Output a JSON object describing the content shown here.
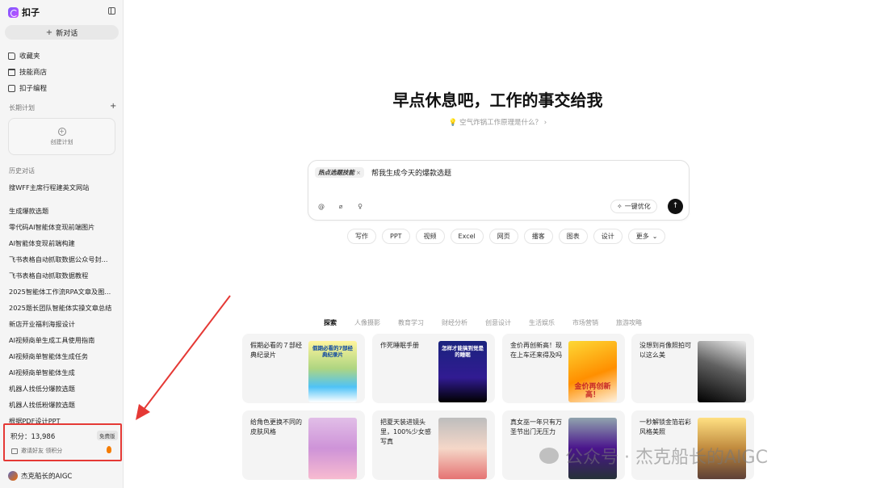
{
  "app": {
    "name": "扣子"
  },
  "sidebar": {
    "new_chat": "新对话",
    "nav": [
      {
        "label": "收藏夹",
        "icon": "folder-icon"
      },
      {
        "label": "技能商店",
        "icon": "store-icon"
      },
      {
        "label": "扣子编程",
        "icon": "code-icon"
      }
    ],
    "long_term_plan": {
      "title": "长期计划",
      "create": "创建计划"
    },
    "history_title": "历史对话",
    "history": [
      "搜WFF主席行程建英文网站",
      "生成爆款选题",
      "零代码AI智能体变现前端图片",
      "AI智能体变现前端构建",
      "飞书表格自动抓取数据公众号封...",
      "飞书表格自动抓取数据教程",
      "2025智能体工作流RPA文章及图...",
      "2025题长团队智能体实操文章总结",
      "新店开业福利海报设计",
      "AI视频商单生成工具使用指南",
      "AI视频商单智能体生成任务",
      "AI视频商单智能体生成",
      "机器人找低分爆款选题",
      "机器人找低粉爆款选题",
      "根据PDF设计PPT"
    ],
    "points": {
      "label": "积分：13,986",
      "badge": "免费版",
      "invite": "邀请好友 领积分"
    },
    "user": {
      "name": "杰克船长的AIGC"
    }
  },
  "main": {
    "title": "早点休息吧，工作的事交给我",
    "hint": "空气炸锅工作原理是什么？",
    "input": {
      "skill": "热点选题技能",
      "text": "帮我生成今天的爆款选题",
      "optimize": "一键优化"
    },
    "quick": [
      "写作",
      "PPT",
      "视频",
      "Excel",
      "网页",
      "播客",
      "图表",
      "设计",
      "更多"
    ],
    "categories": [
      "探索",
      "人像摄影",
      "教育学习",
      "财经分析",
      "创意设计",
      "生活娱乐",
      "市场营销",
      "旅游攻略"
    ],
    "cards": [
      {
        "text": "假期必看的７部经典纪录片",
        "img_caption": "假期必看的7部经典纪录片"
      },
      {
        "text": "作死睡眠手册",
        "img_caption": "怎样才能搞到觉是的睡眠"
      },
      {
        "text": "金价再创新高！现在上车还来得及吗",
        "img_caption": "金价再创新高！"
      },
      {
        "text": "没想到肖像照拍可以这么美",
        "img_caption": ""
      },
      {
        "text": "给角色更换不同的皮肤风格",
        "img_caption": ""
      },
      {
        "text": "把夏天装进镜头里，100%少女感写真",
        "img_caption": ""
      },
      {
        "text": "真女巫一年只有万圣节出门无压力",
        "img_caption": ""
      },
      {
        "text": "一秒解锁金箔岩彩风格美照",
        "img_caption": ""
      }
    ]
  },
  "watermark": "公众号 · 杰克船长的AIGC",
  "colors": {
    "accent_red": "#e53935",
    "send_button": "#111111"
  }
}
